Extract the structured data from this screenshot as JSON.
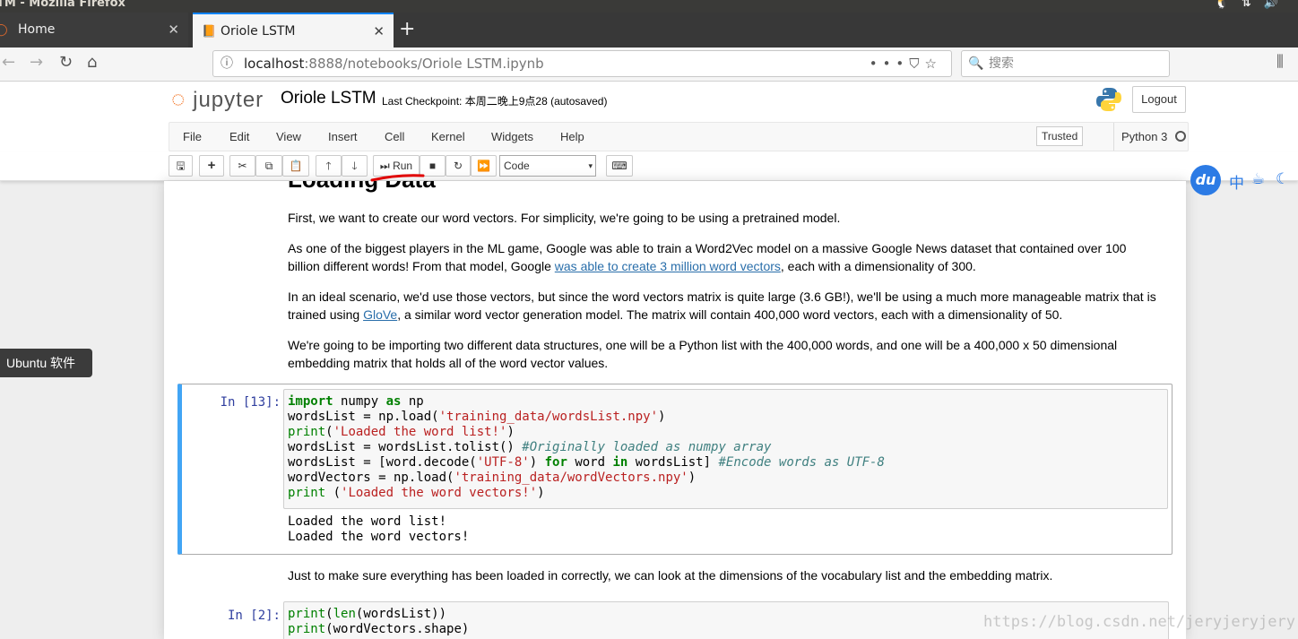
{
  "window": {
    "title": "TM - Mozilla Firefox",
    "tray_icons": [
      "tux-icon",
      "updown-arrows-icon",
      "speaker-icon"
    ]
  },
  "tabs": [
    {
      "label": "Home",
      "active": false
    },
    {
      "label": "Oriole LSTM",
      "active": true
    }
  ],
  "nav": {
    "url_host": "localhost",
    "url_rest": ":8888/notebooks/Oriole LSTM.ipynb",
    "search_placeholder": "搜索"
  },
  "jupyter": {
    "logo_text": "jupyter",
    "notebook_name": "Oriole LSTM",
    "checkpoint": "Last Checkpoint: 本周二晚上9点28   (autosaved)",
    "logout": "Logout",
    "menu": [
      "File",
      "Edit",
      "View",
      "Insert",
      "Cell",
      "Kernel",
      "Widgets",
      "Help"
    ],
    "trusted": "Trusted",
    "kernel": "Python 3",
    "run_label": "Run",
    "cell_type": "Code"
  },
  "baidu": {
    "du": "du",
    "zh": "中"
  },
  "notebook": {
    "heading": "Loading Data",
    "p1": "First, we want to create our word vectors. For simplicity, we're going to be using a pretrained model.",
    "p2_a": "As one of the biggest players in the ML game, Google was able to train a Word2Vec model on a massive Google News dataset that contained over 100 billion different words! From that model, Google ",
    "p2_link": "was able to create 3 million word vectors",
    "p2_b": ", each with a dimensionality of 300.",
    "p3_a": "In an ideal scenario, we'd use those vectors, but since the word vectors matrix is quite large (3.6 GB!), we'll be using a much more manageable matrix that is trained using ",
    "p3_link": "GloVe",
    "p3_b": ", a similar word vector generation model. The matrix will contain 400,000 word vectors, each with a dimensionality of 50.",
    "p4": "We're going to be importing two different data structures, one will be a Python list with the 400,000 words, and one will be a 400,000 x 50 dimensional embedding matrix that holds all of the word vector values.",
    "cell1_prompt": "In [13]:",
    "cell1_output": [
      "Loaded the word list!",
      "Loaded the word vectors!"
    ],
    "p5": "Just to make sure everything has been loaded in correctly, we can look at the dimensions of the vocabulary list and the embedding matrix.",
    "cell2_prompt": "In [2]:"
  },
  "tooltip": "Ubuntu 软件",
  "watermark": "https://blog.csdn.net/jeryjeryjery",
  "colors": {
    "accent": "#42a5f5",
    "jupyter_orange": "#f37626",
    "link": "#296eaa",
    "prompt": "#303f9f"
  }
}
